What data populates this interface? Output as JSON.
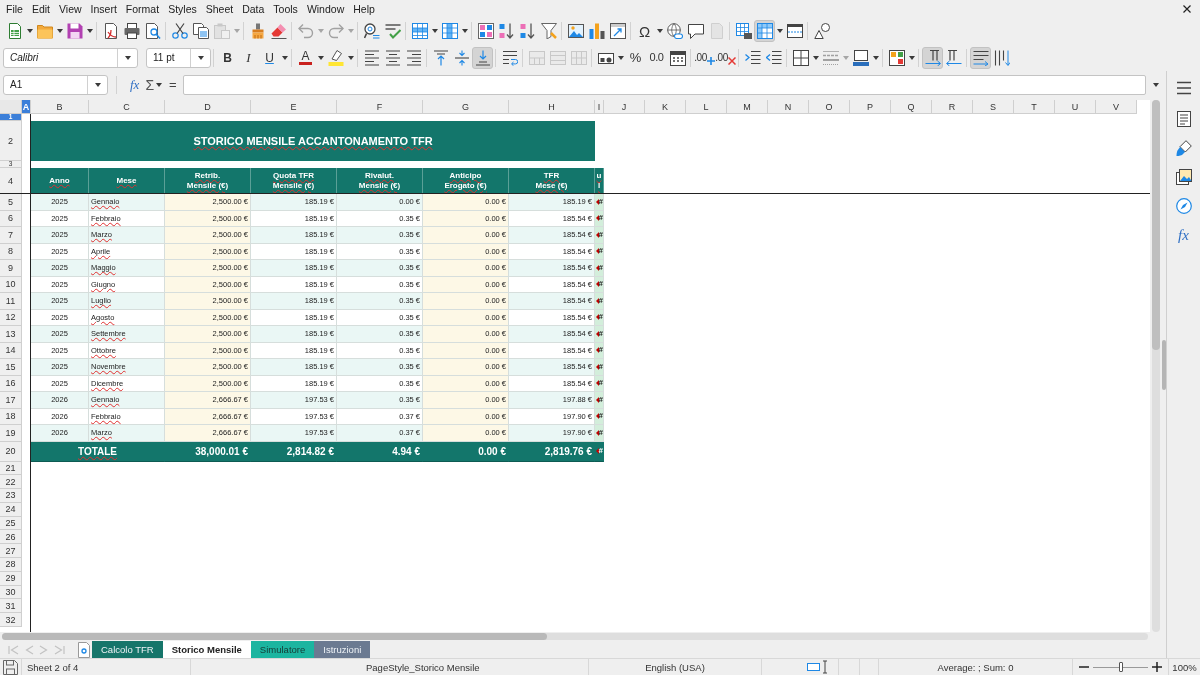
{
  "menu_bar": {
    "items": [
      "File",
      "Edit",
      "View",
      "Insert",
      "Format",
      "Styles",
      "Sheet",
      "Data",
      "Tools",
      "Window",
      "Help"
    ]
  },
  "standard_toolbar": {
    "groups": [
      [
        {
          "pressed": false,
          "disabled": false,
          "menu": true
        },
        {
          "pressed": false,
          "disabled": false,
          "menu": true
        },
        {
          "pressed": false,
          "disabled": false,
          "menu": true
        }
      ],
      [
        {
          "pressed": false,
          "disabled": false
        },
        {
          "pressed": false,
          "disabled": false
        },
        {
          "pressed": false,
          "disabled": false
        }
      ],
      [
        {
          "pressed": false,
          "disabled": false
        },
        {
          "pressed": false,
          "disabled": false
        },
        {
          "pressed": false,
          "disabled": true,
          "menu": true
        }
      ],
      [
        {
          "pressed": false,
          "disabled": false
        },
        {
          "pressed": false,
          "disabled": false
        }
      ],
      [
        {
          "pressed": false,
          "disabled": true,
          "menu": true
        },
        {
          "pressed": false,
          "disabled": true,
          "menu": true
        }
      ],
      [
        {
          "pressed": false,
          "disabled": false
        },
        {
          "pressed": false,
          "disabled": false
        }
      ],
      [
        {
          "pressed": false,
          "disabled": false,
          "menu": true
        },
        {
          "pressed": false,
          "disabled": false,
          "menu": true
        }
      ],
      [
        {
          "pressed": false,
          "disabled": false
        },
        {
          "pressed": false,
          "disabled": false
        },
        {
          "pressed": false,
          "disabled": false
        },
        {
          "pressed": false,
          "disabled": false
        }
      ],
      [
        {
          "pressed": false,
          "disabled": false
        },
        {
          "pressed": false,
          "disabled": false
        },
        {
          "pressed": false,
          "disabled": false
        }
      ],
      [
        {
          "label": "Ω",
          "pressed": false,
          "disabled": false,
          "menu": true
        },
        {
          "pressed": false,
          "disabled": false
        },
        {
          "pressed": false,
          "disabled": false
        },
        {
          "pressed": false,
          "disabled": true
        }
      ],
      [
        {
          "pressed": false,
          "disabled": false
        },
        {
          "pressed": true,
          "disabled": false,
          "menu": true
        },
        {
          "pressed": false,
          "disabled": false
        }
      ],
      [
        {
          "pressed": false,
          "disabled": false
        }
      ]
    ]
  },
  "formatting_toolbar": {
    "font_name": "Calibri",
    "font_size": "11 pt",
    "groups": [
      [
        {
          "label": "B",
          "pressed": false,
          "disabled": false
        },
        {
          "label": "I",
          "pressed": false,
          "disabled": false
        },
        {
          "label": "U",
          "pressed": false,
          "disabled": false,
          "menu": true
        }
      ],
      [
        {
          "label": "A",
          "pressed": false,
          "disabled": false,
          "menu": true
        },
        {
          "pressed": false,
          "disabled": false,
          "menu": true
        }
      ],
      [
        {
          "pressed": false,
          "disabled": false
        },
        {
          "pressed": false,
          "disabled": false
        },
        {
          "pressed": false,
          "disabled": false
        }
      ],
      [
        {
          "pressed": false,
          "disabled": false
        },
        {
          "pressed": false,
          "disabled": false
        },
        {
          "pressed": true,
          "disabled": false
        }
      ],
      [
        {
          "pressed": false,
          "disabled": false
        }
      ],
      [
        {
          "pressed": false,
          "disabled": true
        },
        {
          "pressed": false,
          "disabled": true
        },
        {
          "pressed": false,
          "disabled": true
        }
      ],
      [
        {
          "pressed": false,
          "disabled": false,
          "menu": true
        },
        {
          "label": "%",
          "pressed": false,
          "disabled": false
        },
        {
          "label": "0.0",
          "pressed": false,
          "disabled": false
        },
        {
          "pressed": false,
          "disabled": false
        }
      ],
      [
        {
          "label": ".00",
          "pressed": false,
          "disabled": false
        },
        {
          "label": ".00",
          "pressed": false,
          "disabled": false
        }
      ],
      [
        {
          "pressed": false,
          "disabled": false
        },
        {
          "pressed": false,
          "disabled": false
        }
      ],
      [
        {
          "pressed": false,
          "disabled": false,
          "menu": true
        },
        {
          "pressed": false,
          "disabled": true,
          "menu": true
        },
        {
          "pressed": false,
          "disabled": false,
          "menu": true
        }
      ],
      [
        {
          "pressed": false,
          "disabled": false,
          "menu": true
        }
      ],
      [
        {
          "pressed": true,
          "disabled": false
        },
        {
          "pressed": false,
          "disabled": false
        }
      ],
      [
        {
          "pressed": true,
          "disabled": false
        },
        {
          "pressed": false,
          "disabled": false
        }
      ]
    ]
  },
  "formula_bar": {
    "name_box": "A1",
    "function_wizard": "fx",
    "sum": "Σ",
    "formula": "="
  },
  "sheet": {
    "column_headers": [
      {
        "label": "A",
        "selected": true
      },
      {
        "label": "B",
        "selected": false
      },
      {
        "label": "C",
        "selected": false
      },
      {
        "label": "D",
        "selected": false
      },
      {
        "label": "E",
        "selected": false
      },
      {
        "label": "F",
        "selected": false
      },
      {
        "label": "G",
        "selected": false
      },
      {
        "label": "H",
        "selected": false
      },
      {
        "label": "I",
        "selected": false
      },
      {
        "label": "J",
        "selected": false
      },
      {
        "label": "K",
        "selected": false
      },
      {
        "label": "L",
        "selected": false
      },
      {
        "label": "M",
        "selected": false
      },
      {
        "label": "N",
        "selected": false
      },
      {
        "label": "O",
        "selected": false
      },
      {
        "label": "P",
        "selected": false
      },
      {
        "label": "Q",
        "selected": false
      },
      {
        "label": "R",
        "selected": false
      },
      {
        "label": "S",
        "selected": false
      },
      {
        "label": "T",
        "selected": false
      },
      {
        "label": "U",
        "selected": false
      },
      {
        "label": "V",
        "selected": false
      }
    ],
    "row_numbers": [
      {
        "label": "1",
        "selected": true
      },
      {
        "label": "2",
        "selected": false
      },
      {
        "label": "3",
        "selected": false
      },
      {
        "label": "4",
        "selected": false
      },
      {
        "label": "5",
        "selected": false
      },
      {
        "label": "6",
        "selected": false
      },
      {
        "label": "7",
        "selected": false
      },
      {
        "label": "8",
        "selected": false
      },
      {
        "label": "9",
        "selected": false
      },
      {
        "label": "10",
        "selected": false
      },
      {
        "label": "11",
        "selected": false
      },
      {
        "label": "12",
        "selected": false
      },
      {
        "label": "13",
        "selected": false
      },
      {
        "label": "14",
        "selected": false
      },
      {
        "label": "15",
        "selected": false
      },
      {
        "label": "16",
        "selected": false
      },
      {
        "label": "17",
        "selected": false
      },
      {
        "label": "18",
        "selected": false
      },
      {
        "label": "19",
        "selected": false
      },
      {
        "label": "20",
        "selected": false
      },
      {
        "label": "21",
        "selected": false
      },
      {
        "label": "22",
        "selected": false
      },
      {
        "label": "23",
        "selected": false
      },
      {
        "label": "24",
        "selected": false
      },
      {
        "label": "25",
        "selected": false
      },
      {
        "label": "26",
        "selected": false
      },
      {
        "label": "27",
        "selected": false
      },
      {
        "label": "28",
        "selected": false
      },
      {
        "label": "29",
        "selected": false
      },
      {
        "label": "30",
        "selected": false
      },
      {
        "label": "31",
        "selected": false
      },
      {
        "label": "32",
        "selected": false
      }
    ],
    "title": "STORICO MENSILE ACCANTONAMENTO TFR",
    "table": {
      "columns": [
        "Anno",
        "Mese",
        "Retrib.\nMensile (€)",
        "Quota TFR\nMensile (€)",
        "Rivalut.\nMensile (€)",
        "Anticipo\nErogato (€)",
        "TFR\nMese (€)",
        "u\nl"
      ],
      "rows": [
        {
          "anno": "2025",
          "mese": "Gennaio",
          "retrib_mensile": "2,500.00 €",
          "quota_tfr_mensile": "185.19 €",
          "rivalut_mensile": "0.00 €",
          "anticipo_erogato": "0.00 €",
          "tfr_mese": "185.19 €",
          "column_8": "#"
        },
        {
          "anno": "2025",
          "mese": "Febbraio",
          "retrib_mensile": "2,500.00 €",
          "quota_tfr_mensile": "185.19 €",
          "rivalut_mensile": "0.35 €",
          "anticipo_erogato": "0.00 €",
          "tfr_mese": "185.54 €",
          "column_8": "#"
        },
        {
          "anno": "2025",
          "mese": "Marzo",
          "retrib_mensile": "2,500.00 €",
          "quota_tfr_mensile": "185.19 €",
          "rivalut_mensile": "0.35 €",
          "anticipo_erogato": "0.00 €",
          "tfr_mese": "185.54 €",
          "column_8": "#"
        },
        {
          "anno": "2025",
          "mese": "Aprile",
          "retrib_mensile": "2,500.00 €",
          "quota_tfr_mensile": "185.19 €",
          "rivalut_mensile": "0.35 €",
          "anticipo_erogato": "0.00 €",
          "tfr_mese": "185.54 €",
          "column_8": "#"
        },
        {
          "anno": "2025",
          "mese": "Maggio",
          "retrib_mensile": "2,500.00 €",
          "quota_tfr_mensile": "185.19 €",
          "rivalut_mensile": "0.35 €",
          "anticipo_erogato": "0.00 €",
          "tfr_mese": "185.54 €",
          "column_8": "#"
        },
        {
          "anno": "2025",
          "mese": "Giugno",
          "retrib_mensile": "2,500.00 €",
          "quota_tfr_mensile": "185.19 €",
          "rivalut_mensile": "0.35 €",
          "anticipo_erogato": "0.00 €",
          "tfr_mese": "185.54 €",
          "column_8": "#"
        },
        {
          "anno": "2025",
          "mese": "Luglio",
          "retrib_mensile": "2,500.00 €",
          "quota_tfr_mensile": "185.19 €",
          "rivalut_mensile": "0.35 €",
          "anticipo_erogato": "0.00 €",
          "tfr_mese": "185.54 €",
          "column_8": "#"
        },
        {
          "anno": "2025",
          "mese": "Agosto",
          "retrib_mensile": "2,500.00 €",
          "quota_tfr_mensile": "185.19 €",
          "rivalut_mensile": "0.35 €",
          "anticipo_erogato": "0.00 €",
          "tfr_mese": "185.54 €",
          "column_8": "#"
        },
        {
          "anno": "2025",
          "mese": "Settembre",
          "retrib_mensile": "2,500.00 €",
          "quota_tfr_mensile": "185.19 €",
          "rivalut_mensile": "0.35 €",
          "anticipo_erogato": "0.00 €",
          "tfr_mese": "185.54 €",
          "column_8": "#"
        },
        {
          "anno": "2025",
          "mese": "Ottobre",
          "retrib_mensile": "2,500.00 €",
          "quota_tfr_mensile": "185.19 €",
          "rivalut_mensile": "0.35 €",
          "anticipo_erogato": "0.00 €",
          "tfr_mese": "185.54 €",
          "column_8": "#"
        },
        {
          "anno": "2025",
          "mese": "Novembre",
          "retrib_mensile": "2,500.00 €",
          "quota_tfr_mensile": "185.19 €",
          "rivalut_mensile": "0.35 €",
          "anticipo_erogato": "0.00 €",
          "tfr_mese": "185.54 €",
          "column_8": "#"
        },
        {
          "anno": "2025",
          "mese": "Dicembre",
          "retrib_mensile": "2,500.00 €",
          "quota_tfr_mensile": "185.19 €",
          "rivalut_mensile": "0.35 €",
          "anticipo_erogato": "0.00 €",
          "tfr_mese": "185.54 €",
          "column_8": "#"
        },
        {
          "anno": "2026",
          "mese": "Gennaio",
          "retrib_mensile": "2,666.67 €",
          "quota_tfr_mensile": "197.53 €",
          "rivalut_mensile": "0.35 €",
          "anticipo_erogato": "0.00 €",
          "tfr_mese": "197.88 €",
          "column_8": "#"
        },
        {
          "anno": "2026",
          "mese": "Febbraio",
          "retrib_mensile": "2,666.67 €",
          "quota_tfr_mensile": "197.53 €",
          "rivalut_mensile": "0.37 €",
          "anticipo_erogato": "0.00 €",
          "tfr_mese": "197.90 €",
          "column_8": "#"
        },
        {
          "anno": "2026",
          "mese": "Marzo",
          "retrib_mensile": "2,666.67 €",
          "quota_tfr_mensile": "197.53 €",
          "rivalut_mensile": "0.37 €",
          "anticipo_erogato": "0.00 €",
          "tfr_mese": "197.90 €",
          "column_8": "#"
        }
      ],
      "total": {
        "label": "TOTALE",
        "retrib_mensile": "38,000.01 €",
        "quota_tfr_mensile": "2,814.82 €",
        "rivalut_mensile": "4.94 €",
        "anticipo_erogato": "0.00 €",
        "tfr_mese": "2,819.76 €",
        "column_8": "#"
      }
    }
  },
  "sheet_navigation": [
    {
      "disabled": true
    },
    {
      "disabled": true
    },
    {
      "disabled": true
    },
    {
      "disabled": true
    }
  ],
  "sheet_tabs": [
    {
      "label": "Calcolo TFR",
      "selected": false,
      "color": "#16756a"
    },
    {
      "label": "Storico Mensile",
      "selected": true
    },
    {
      "label": "Simulatore",
      "selected": false,
      "color": "#1cb5a0"
    },
    {
      "label": "Istruzioni",
      "selected": false,
      "color": "#6b7a91"
    }
  ],
  "sidebar": {
    "buttons": [
      {
        "selected": false
      },
      {
        "selected": false
      },
      {
        "selected": false
      },
      {
        "selected": false
      },
      {
        "selected": false,
        "label": "fx"
      }
    ]
  },
  "status_bar": {
    "sheet": "Sheet 2 of 4",
    "page_style": "PageStyle_Storico Mensile",
    "language": "English (USA)",
    "summary": "Average: ; Sum: 0",
    "zoom": {
      "level": 0.5,
      "value": "100%"
    }
  }
}
